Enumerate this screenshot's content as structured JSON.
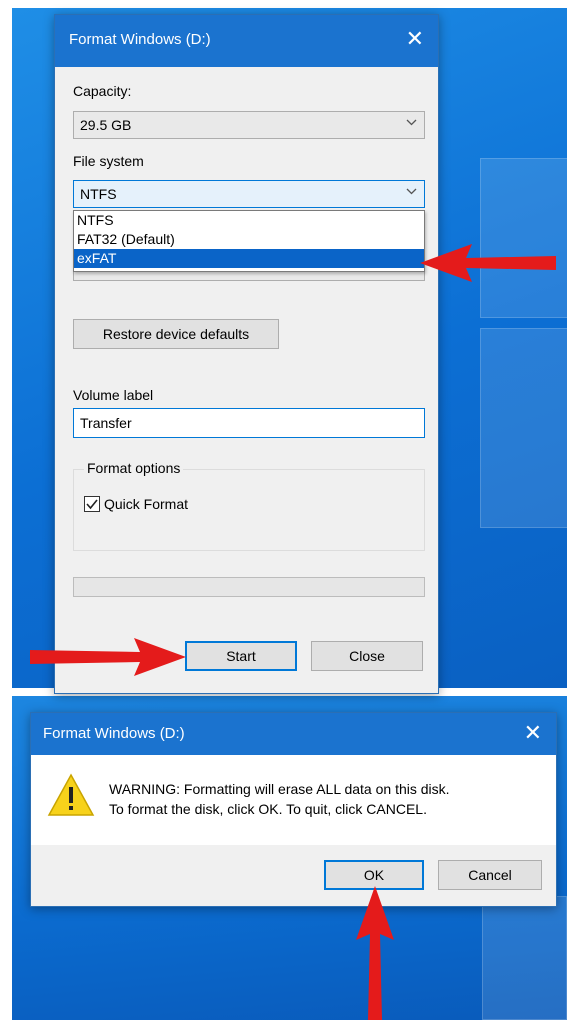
{
  "format_dialog": {
    "title": "Format Windows (D:)",
    "close_glyph": "✕",
    "capacity_label": "Capacity:",
    "capacity_value": "29.5 GB",
    "filesystem_label": "File system",
    "filesystem_value": "NTFS",
    "filesystem_options": [
      "NTFS",
      "FAT32 (Default)",
      "exFAT"
    ],
    "filesystem_highlighted": "exFAT",
    "restore_button": "Restore device defaults",
    "volume_label_label": "Volume label",
    "volume_label_value": "Transfer",
    "format_options_label": "Format options",
    "quick_format_label": "Quick Format",
    "quick_format_checked": true,
    "start_button": "Start",
    "close_button": "Close"
  },
  "warning_dialog": {
    "title": "Format Windows (D:)",
    "close_glyph": "✕",
    "message_line1": "WARNING: Formatting will erase ALL data on this disk.",
    "message_line2": "To format the disk, click OK. To quit, click CANCEL.",
    "ok_button": "OK",
    "cancel_button": "Cancel"
  },
  "icons": {
    "chevron": "chevron-down-icon",
    "warning": "warning-triangle-icon",
    "arrow": "red-arrow-icon"
  },
  "colors": {
    "titlebar": "#1b73cf",
    "desktop": "#0c6fd4",
    "arrow": "#e41b1b",
    "selection": "#0a64c8",
    "focus_border": "#0078d7"
  }
}
